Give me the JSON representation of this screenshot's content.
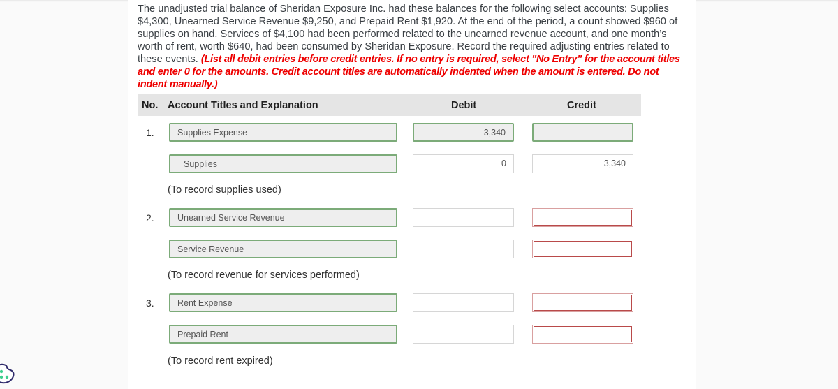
{
  "question": {
    "text": "The unadjusted trial balance of Sheridan Exposure Inc. had these balances for the following select accounts: Supplies $4,300, Unearned Service Revenue $9,250, and Prepaid Rent $1,920. At the end of the period, a count showed $960 of supplies on hand. Services of $4,100 had been performed related to the unearned revenue account, and one month’s worth of rent, worth $640, had been consumed by Sheridan Exposure. Record the required adjusting entries related to these events. ",
    "instructions": "(List all debit entries before credit entries. If no entry is required, select \"No Entry\" for the account titles and enter 0 for the amounts. Credit account titles are automatically indented when the amount is entered. Do not indent manually.)"
  },
  "table": {
    "headers": {
      "no": "No.",
      "account": "Account Titles and Explanation",
      "debit": "Debit",
      "credit": "Credit"
    },
    "entries": [
      {
        "no": "1.",
        "lines": [
          {
            "account": "Supplies Expense",
            "debit": "3,340",
            "credit": "",
            "debit_state": "correct",
            "credit_state": "correct"
          },
          {
            "account": "Supplies",
            "debit": "0",
            "credit": "3,340",
            "debit_state": "neutral",
            "credit_state": "neutral"
          }
        ],
        "explanation": "(To record supplies used)"
      },
      {
        "no": "2.",
        "lines": [
          {
            "account": "Unearned Service Revenue",
            "debit": "",
            "credit": "",
            "debit_state": "neutral",
            "credit_state": "error"
          },
          {
            "account": "Service Revenue",
            "debit": "",
            "credit": "",
            "debit_state": "neutral",
            "credit_state": "error"
          }
        ],
        "explanation": "(To record revenue for services performed)"
      },
      {
        "no": "3.",
        "lines": [
          {
            "account": "Rent Expense",
            "debit": "",
            "credit": "",
            "debit_state": "neutral",
            "credit_state": "error"
          },
          {
            "account": "Prepaid Rent",
            "debit": "",
            "credit": "",
            "debit_state": "neutral",
            "credit_state": "error"
          }
        ],
        "explanation": "(To record rent expired)"
      }
    ]
  },
  "colors": {
    "correct_border": "#7cab79",
    "error_border": "#b94a4a",
    "instruction_text": "#ee0000"
  }
}
